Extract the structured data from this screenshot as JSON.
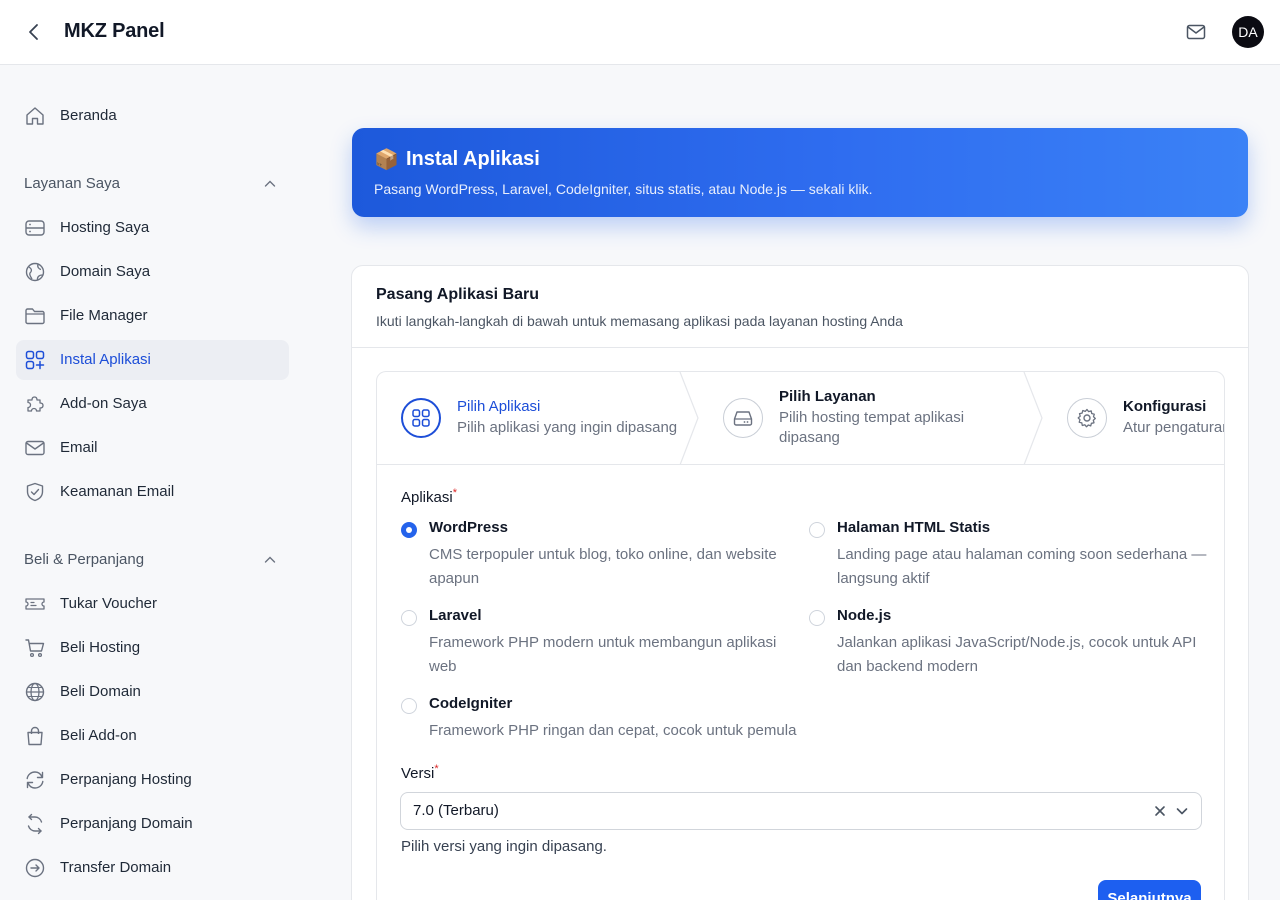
{
  "header": {
    "title": "MKZ Panel",
    "avatar_initials": "DA"
  },
  "sidebar": {
    "home": "Beranda",
    "section_services": "Layanan Saya",
    "services": [
      "Hosting Saya",
      "Domain Saya",
      "File Manager",
      "Instal Aplikasi",
      "Add-on Saya",
      "Email",
      "Keamanan Email"
    ],
    "section_buy": "Beli & Perpanjang",
    "buy": [
      "Tukar Voucher",
      "Beli Hosting",
      "Beli Domain",
      "Beli Add-on",
      "Perpanjang Hosting",
      "Perpanjang Domain",
      "Transfer Domain"
    ],
    "active_item": "Instal Aplikasi"
  },
  "banner": {
    "icon": "📦",
    "title": "Instal Aplikasi",
    "subtitle": "Pasang WordPress, Laravel, CodeIgniter, situs statis, atau Node.js — sekali klik."
  },
  "card": {
    "title": "Pasang Aplikasi Baru",
    "subtitle": "Ikuti langkah-langkah di bawah untuk memasang aplikasi pada layanan hosting Anda"
  },
  "steps": [
    {
      "title": "Pilih Aplikasi",
      "desc": "Pilih aplikasi yang ingin dipasang",
      "icon": "grid-icon",
      "active": true
    },
    {
      "title": "Pilih Layanan",
      "desc": "Pilih hosting tempat aplikasi dipasang",
      "icon": "server-icon",
      "active": false
    },
    {
      "title": "Konfigurasi",
      "desc": "Atur pengaturan",
      "icon": "gear-icon",
      "active": false
    }
  ],
  "form": {
    "app_label": "Aplikasi",
    "required_mark": "*",
    "apps": [
      {
        "name": "WordPress",
        "desc": "CMS terpopuler untuk blog, toko online, dan website apapun",
        "selected": true
      },
      {
        "name": "Halaman HTML Statis",
        "desc": "Landing page atau halaman coming soon sederhana — langsung aktif",
        "selected": false
      },
      {
        "name": "Laravel",
        "desc": "Framework PHP modern untuk membangun aplikasi web",
        "selected": false
      },
      {
        "name": "Node.js",
        "desc": "Jalankan aplikasi JavaScript/Node.js, cocok untuk API dan backend modern",
        "selected": false
      },
      {
        "name": "CodeIgniter",
        "desc": "Framework PHP ringan dan cepat, cocok untuk pemula",
        "selected": false
      }
    ],
    "version_label": "Versi",
    "version_value": "7.0 (Terbaru)",
    "version_hint": "Pilih versi yang ingin dipasang.",
    "next_label": "Selanjutnya"
  },
  "colors": {
    "accent": "#2563eb",
    "banner_start": "#1d59db",
    "banner_end": "#3b82f6",
    "avatar_bg": "#0b0b12"
  }
}
